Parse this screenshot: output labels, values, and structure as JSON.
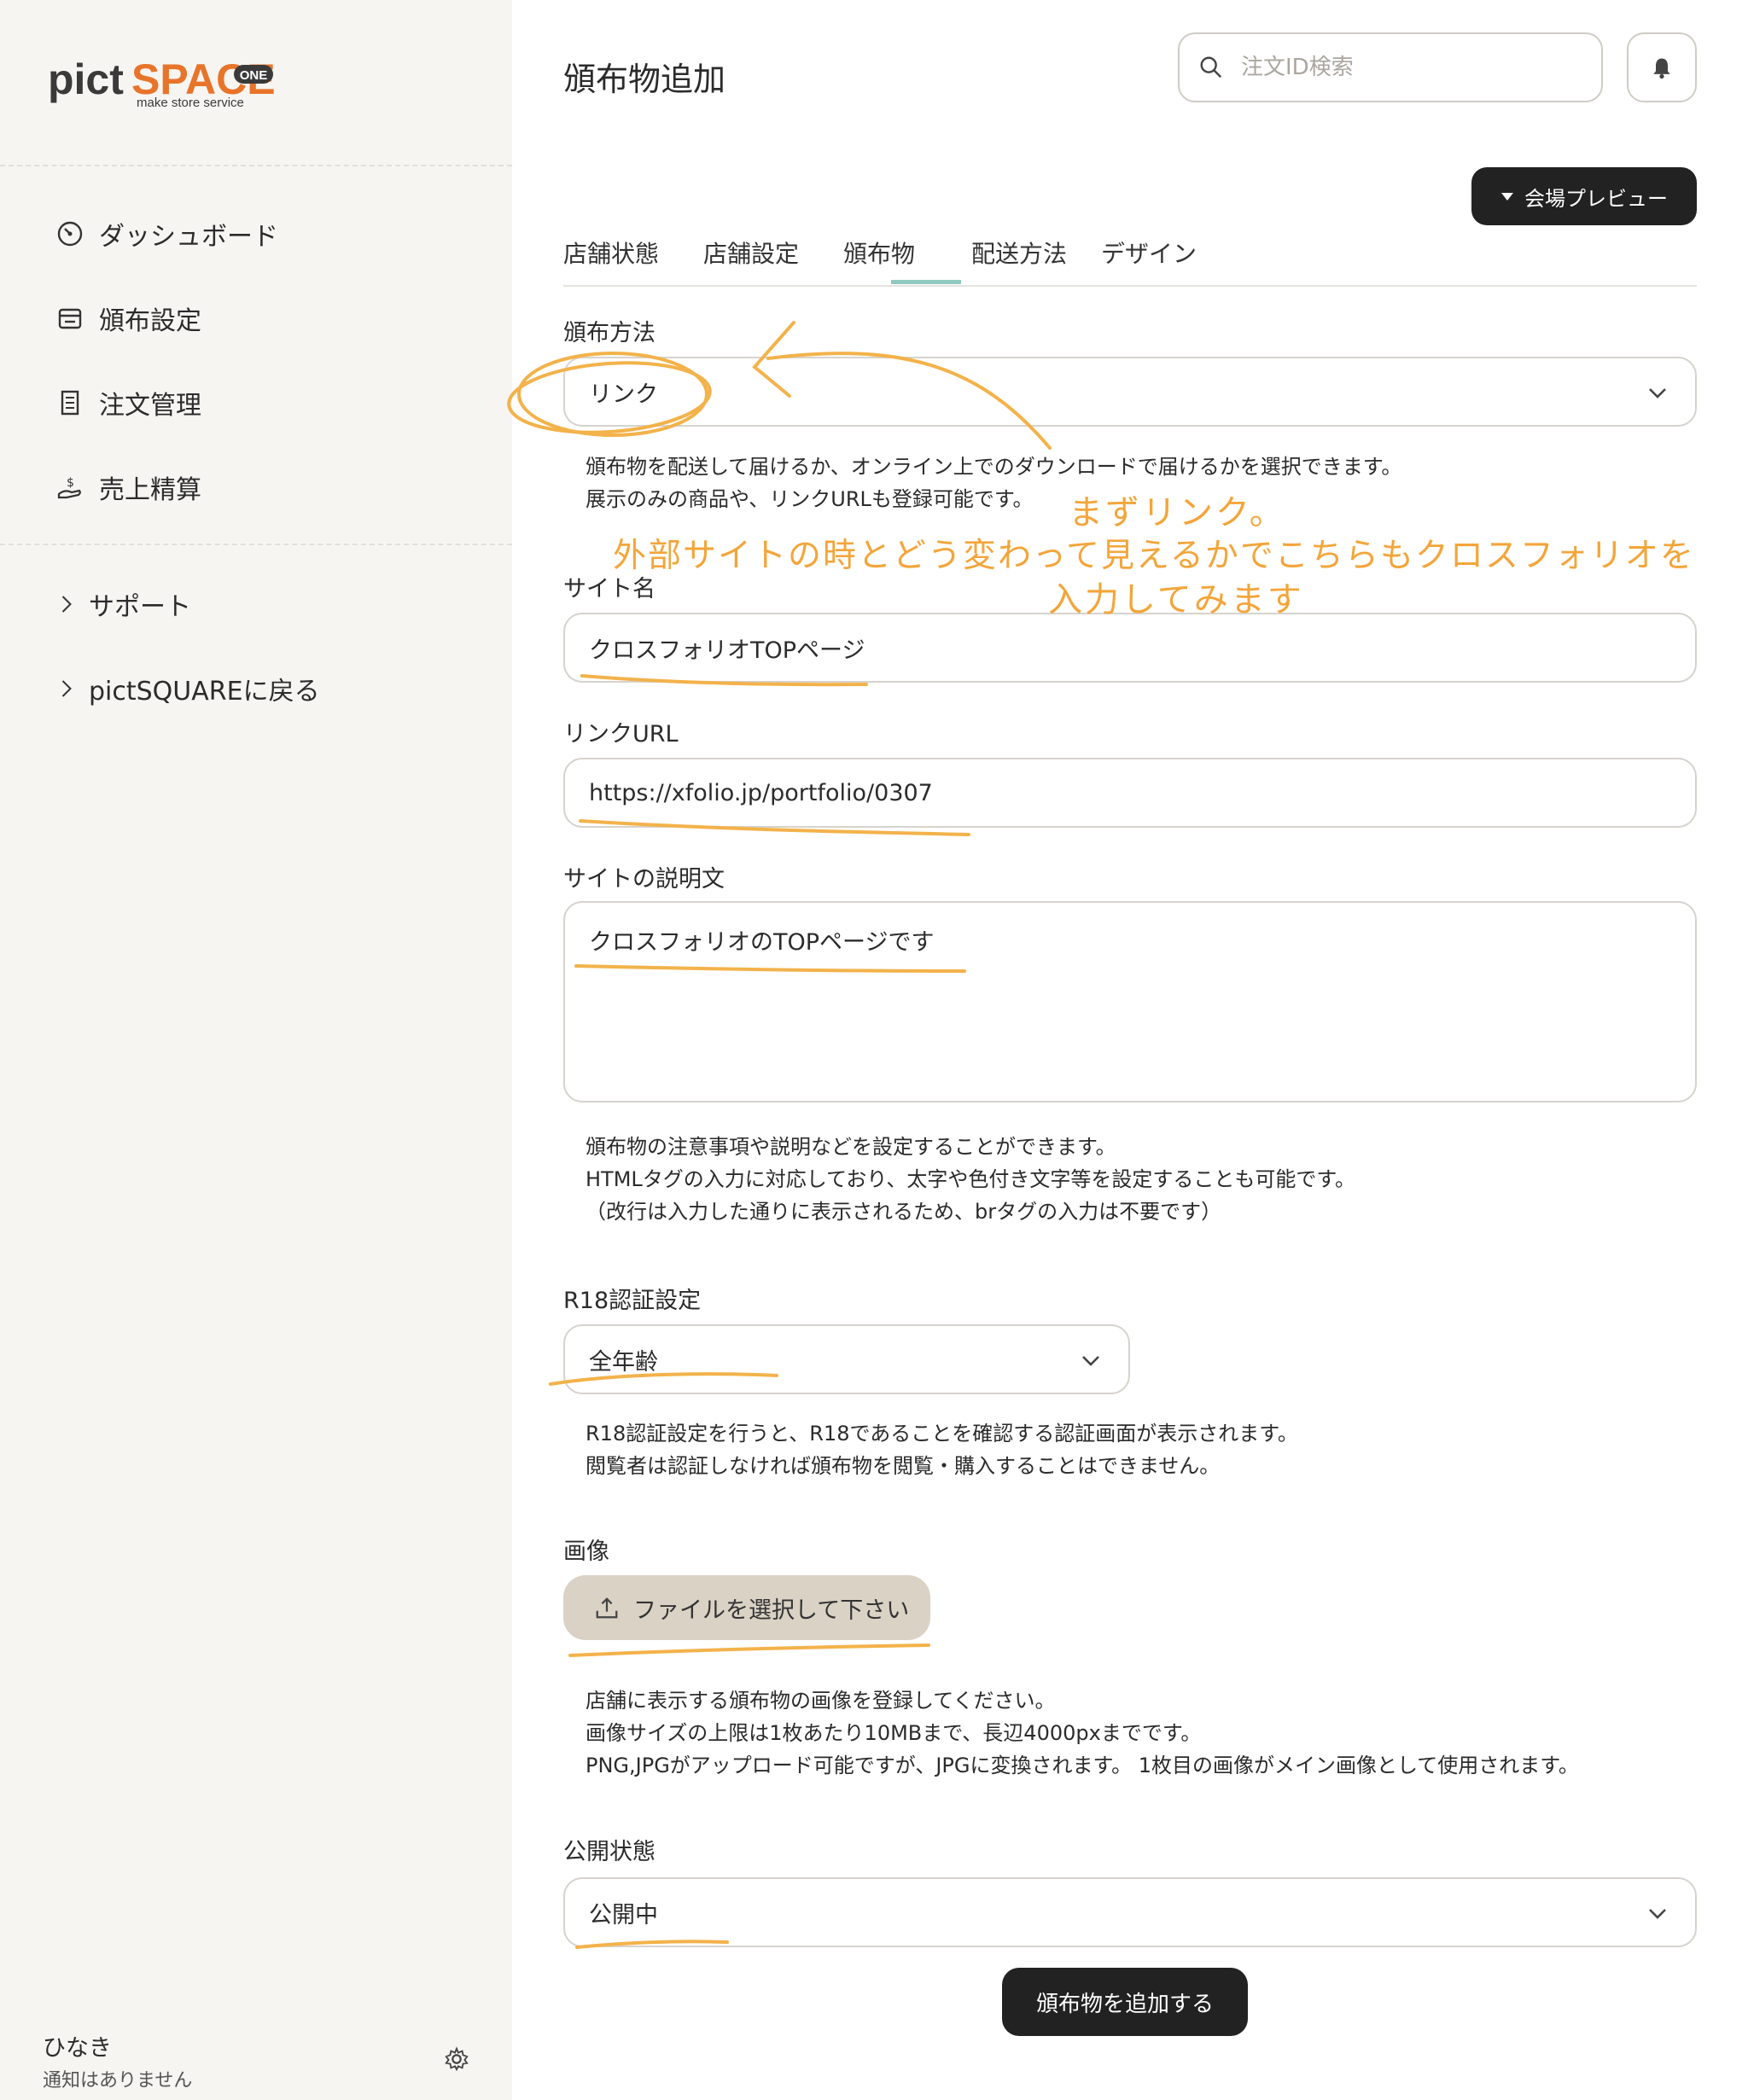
{
  "brand": {
    "name_part1": "pict",
    "name_part2": "SPACE",
    "badge": "ONE",
    "tagline": "make store service"
  },
  "sidebar": {
    "items": [
      {
        "label": "ダッシュボード",
        "icon": "gauge-icon"
      },
      {
        "label": "頒布設定",
        "icon": "store-icon"
      },
      {
        "label": "注文管理",
        "icon": "receipt-icon"
      },
      {
        "label": "売上精算",
        "icon": "coin-hand-icon"
      }
    ],
    "links": [
      {
        "label": "サポート",
        "icon": "chevron-right-icon"
      },
      {
        "label": "pictSQUAREに戻る",
        "icon": "chevron-right-icon"
      }
    ],
    "user": {
      "name": "ひなき",
      "notice": "通知はありません"
    }
  },
  "header": {
    "title": "頒布物追加",
    "search_placeholder": "注文ID検索",
    "preview_label": "会場プレビュー"
  },
  "tabs": [
    {
      "label": "店舗状態"
    },
    {
      "label": "店舗設定"
    },
    {
      "label": "頒布物",
      "active": true
    },
    {
      "label": "配送方法"
    },
    {
      "label": "デザイン"
    }
  ],
  "form": {
    "method": {
      "label": "頒布方法",
      "value": "リンク",
      "help1": "頒布物を配送して届けるか、オンライン上でのダウンロードで届けるかを選択できます。",
      "help2": "展示のみの商品や、リンクURLも登録可能です。"
    },
    "site_name": {
      "label": "サイト名",
      "value": "クロスフォリオTOPページ"
    },
    "link_url": {
      "label": "リンクURL",
      "value": "https://xfolio.jp/portfolio/0307"
    },
    "description": {
      "label": "サイトの説明文",
      "value": "クロスフォリオのTOPページです",
      "help1": "頒布物の注意事項や説明などを設定することができます。",
      "help2": "HTMLタグの入力に対応しており、太字や色付き文字等を設定することも可能です。",
      "help3": "（改行は入力した通りに表示されるため、brタグの入力は不要です）"
    },
    "r18": {
      "label": "R18認証設定",
      "value": "全年齢",
      "help1": "R18認証設定を行うと、R18であることを確認する認証画面が表示されます。",
      "help2": "閲覧者は認証しなければ頒布物を閲覧・購入することはできません。"
    },
    "image": {
      "label": "画像",
      "button": "ファイルを選択して下さい",
      "help1": "店舗に表示する頒布物の画像を登録してください。",
      "help2": "画像サイズの上限は1枚あたり10MBまで、長辺4000pxまでです。",
      "help3": "PNG,JPGがアップロード可能ですが、JPGに変換されます。 1枚目の画像がメイン画像として使用されます。"
    },
    "status": {
      "label": "公開状態",
      "value": "公開中"
    },
    "submit": "頒布物を追加する"
  },
  "annotations": {
    "line1": "まずリンク。",
    "line2": "外部サイトの時とどう変わって見えるかでこちらもクロスフォリオを",
    "line3": "入力してみます"
  },
  "colors": {
    "accent_tab": "#8fc9c0",
    "annotation": "#f3a53a",
    "brand_orange": "#e8742a",
    "upload_bg": "#d9d2c5"
  }
}
